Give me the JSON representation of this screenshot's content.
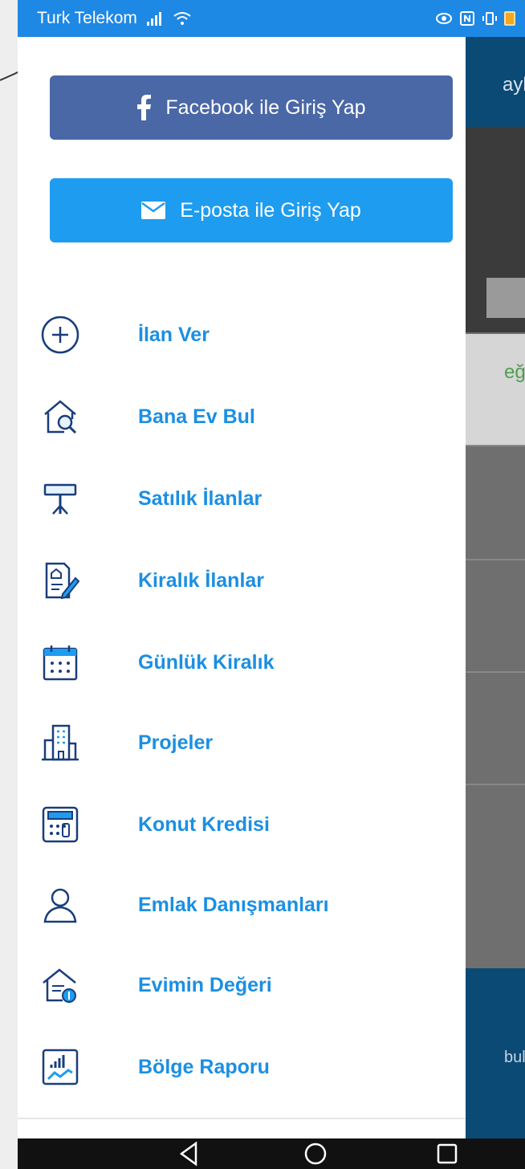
{
  "status_bar": {
    "carrier": "Turk Telekom",
    "signal_icon": "signal-icon",
    "wifi_icon": "wifi-icon",
    "right_icons": [
      "eye-icon",
      "nfc-icon",
      "vibrate-icon",
      "battery-icon"
    ],
    "battery_color": "#f5a623"
  },
  "login": {
    "facebook_label": "Facebook ile Giriş Yap",
    "facebook_icon": "facebook-icon",
    "facebook_color": "#4a67a6",
    "email_label": "E-posta ile Giriş Yap",
    "email_icon": "envelope-icon",
    "email_color": "#1e9cf0"
  },
  "menu": {
    "label_color": "#1b8fe3",
    "items": [
      {
        "label": "İlan Ver",
        "icon": "plus-circle-icon"
      },
      {
        "label": "Bana Ev Bul",
        "icon": "house-search-icon"
      },
      {
        "label": "Satılık İlanlar",
        "icon": "sign-post-icon"
      },
      {
        "label": "Kiralık İlanlar",
        "icon": "document-edit-icon"
      },
      {
        "label": "Günlük Kiralık",
        "icon": "calendar-icon"
      },
      {
        "label": "Projeler",
        "icon": "building-icon"
      },
      {
        "label": "Konut Kredisi",
        "icon": "calculator-icon"
      },
      {
        "label": "Emlak Danışmanları",
        "icon": "person-icon"
      },
      {
        "label": "Evimin Değeri",
        "icon": "house-money-icon"
      },
      {
        "label": "Bölge Raporu",
        "icon": "chart-report-icon"
      }
    ]
  },
  "background_screen": {
    "header_text": "aylı",
    "card_text": "eğiş",
    "bottom_text": "buls"
  },
  "nav_bar": {
    "buttons": [
      "back-icon",
      "home-icon",
      "recents-icon"
    ]
  }
}
